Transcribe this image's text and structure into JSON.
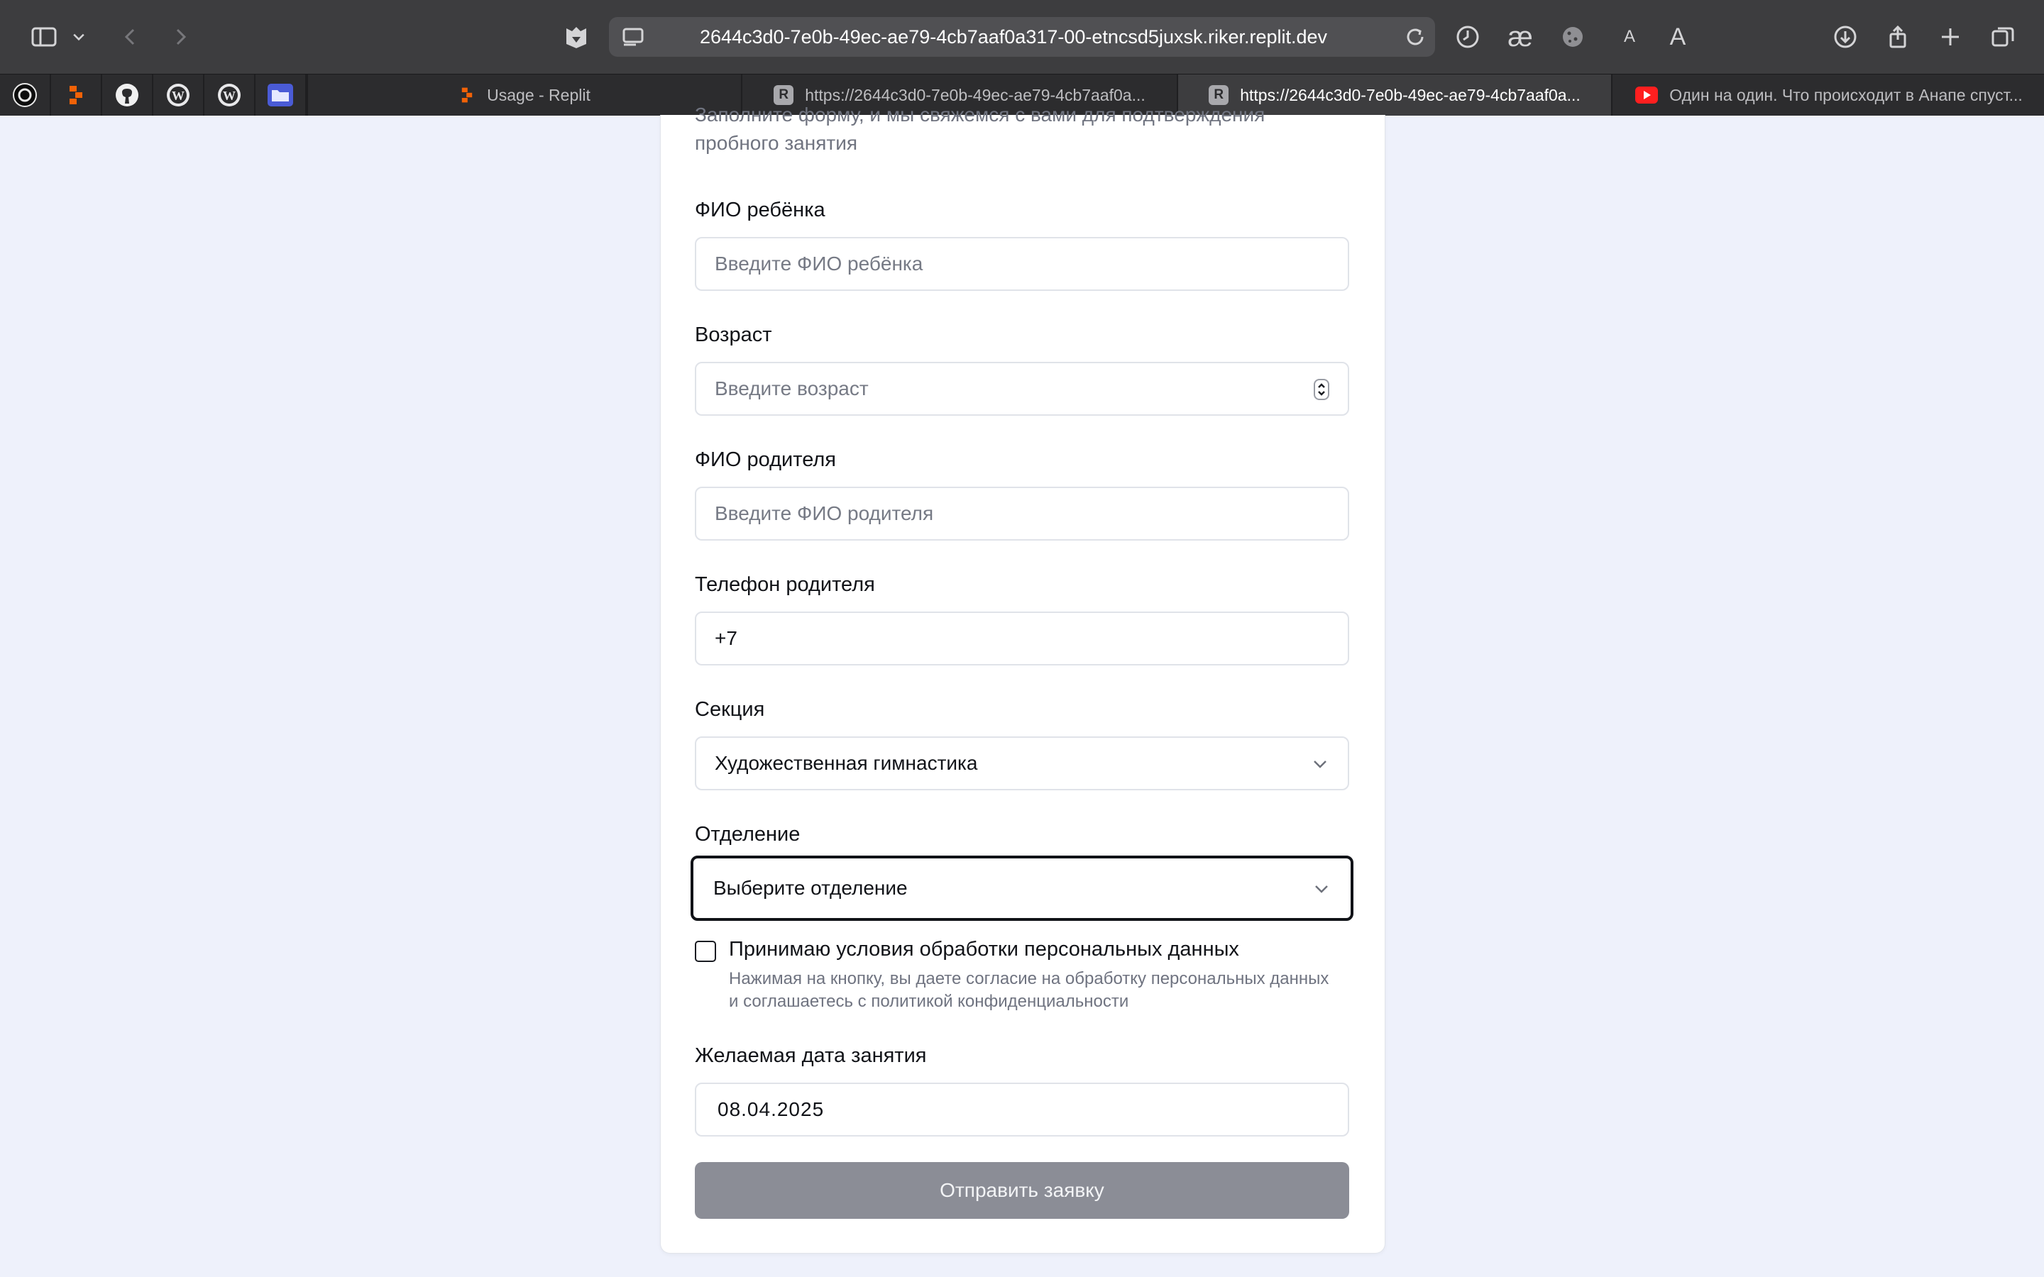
{
  "browser": {
    "url": "2644c3d0-7e0b-49ec-ae79-4cb7aaf0a317-00-etncsd5juxsk.riker.replit.dev",
    "text_size_small": "A",
    "text_size_large": "A",
    "tabs": [
      {
        "label": "Usage - Replit",
        "icon": "replit-icon",
        "active": false
      },
      {
        "label": "https://2644c3d0-7e0b-49ec-ae79-4cb7aaf0a...",
        "icon": "R",
        "active": false
      },
      {
        "label": "https://2644c3d0-7e0b-49ec-ae79-4cb7aaf0a...",
        "icon": "R",
        "active": true
      },
      {
        "label": "Один на один. Что происходит в Анапе спуст...",
        "icon": "youtube-icon",
        "active": false
      }
    ],
    "bookmarks": [
      "openai-icon",
      "replit-icon",
      "github-icon",
      "wordpress-icon",
      "wordpress-icon",
      "folder-icon"
    ]
  },
  "form": {
    "intro": "Заполните форму, и мы свяжемся с вами для подтверждения пробного занятия",
    "child_name": {
      "label": "ФИО ребёнка",
      "placeholder": "Введите ФИО ребёнка"
    },
    "age": {
      "label": "Возраст",
      "placeholder": "Введите возраст"
    },
    "parent_name": {
      "label": "ФИО родителя",
      "placeholder": "Введите ФИО родителя"
    },
    "parent_phone": {
      "label": "Телефон родителя",
      "value": "+7"
    },
    "section": {
      "label": "Секция",
      "value": "Художественная гимнастика"
    },
    "department": {
      "label": "Отделение",
      "value": "Выберите отделение"
    },
    "consent": {
      "label": "Принимаю условия обработки персональных данных",
      "note": "Нажимая на кнопку, вы даете согласие на обработку персональных данных и соглашаетесь с политикой конфиденциальности",
      "checked": false
    },
    "date": {
      "label": "Желаемая дата занятия",
      "value": "08.04.2025"
    },
    "submit_label": "Отправить заявку"
  },
  "colors": {
    "page_bg": "#eef1fb",
    "button_disabled": "#8b8d96",
    "focus_border": "#111318"
  }
}
